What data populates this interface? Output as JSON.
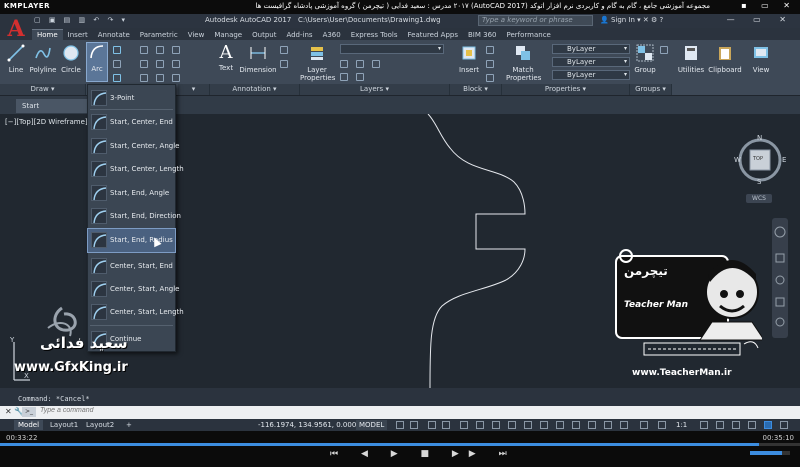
{
  "player": {
    "logo": "KMPLAYER",
    "title": "مجموعه آموزشی جامع ، گام به گام و کاربردی نرم افزار  اتوکد (AutoCAD 2017) ۲۰۱۷  مدرس : سعید فدایی ( تیچرمن ) گروه آموزشی پادشاه گرافیست ها",
    "time_elapsed": "00:33:22",
    "time_total": "00:35:10",
    "progress": 0.949,
    "volume": 0.8
  },
  "titlebar": {
    "app": "Autodesk AutoCAD 2017",
    "path": "C:\\Users\\User\\Documents\\Drawing1.dwg",
    "search_placeholder": "Type a keyword or phrase",
    "signin": "Sign In"
  },
  "tabs": [
    "Home",
    "Insert",
    "Annotate",
    "Parametric",
    "View",
    "Manage",
    "Output",
    "Add-ins",
    "A360",
    "Express Tools",
    "Featured Apps",
    "BIM 360",
    "Performance"
  ],
  "active_tab": "Home",
  "ribbon": {
    "draw": {
      "line": "Line",
      "polyline": "Polyline",
      "circle": "Circle",
      "arc": "Arc",
      "panel": "Draw"
    },
    "annotation": {
      "text": "Text",
      "dimension": "Dimension",
      "panel": "Annotation"
    },
    "layers": {
      "layer_properties": "Layer Properties",
      "panel": "Layers"
    },
    "block": {
      "insert": "Insert",
      "panel": "Block"
    },
    "properties": {
      "match": "Match Properties",
      "bylayer": "ByLayer",
      "panel": "Properties"
    },
    "groups": {
      "group": "Group",
      "panel": "Groups"
    },
    "utilities": "Utilities",
    "clipboard": "Clipboard",
    "view": "View",
    "caret": "▾"
  },
  "file_tab": "Start",
  "viewport_label": "[−][Top][2D Wireframe]",
  "arc_menu": [
    {
      "label": "3-Point",
      "highlight": false
    },
    {
      "label": "Start, Center, End",
      "highlight": false
    },
    {
      "label": "Start, Center, Angle",
      "highlight": false
    },
    {
      "label": "Start, Center, Length",
      "highlight": false
    },
    {
      "label": "Start, End, Angle",
      "highlight": false
    },
    {
      "label": "Start, End, Direction",
      "highlight": false
    },
    {
      "label": "Start, End, Radius",
      "highlight": true
    },
    {
      "label": "Center, Start, End",
      "highlight": false
    },
    {
      "label": "Center, Start, Angle",
      "highlight": false
    },
    {
      "label": "Center, Start, Length",
      "highlight": false
    },
    {
      "label": "Continue",
      "highlight": false
    }
  ],
  "navcube": {
    "n": "N",
    "s": "S",
    "e": "E",
    "w": "W",
    "top": "TOP",
    "wcs": "WCS"
  },
  "watermark": {
    "name_fa": "سعید فدائی",
    "site": "www.GfxKing.ir",
    "tm_site": "www.TeacherMan.ir",
    "tm_brand": "Teacher Man",
    "tm_fa": "تیچرمن"
  },
  "ucs": {
    "y": "Y",
    "x": "X"
  },
  "command": {
    "history": "Command: *Cancel*",
    "placeholder": "Type a command"
  },
  "layout_tabs": [
    "Model",
    "Layout1",
    "Layout2"
  ],
  "status": {
    "coords": "-116.1974, 134.9561, 0.0000",
    "model": "MODEL",
    "scale": "1:1"
  }
}
